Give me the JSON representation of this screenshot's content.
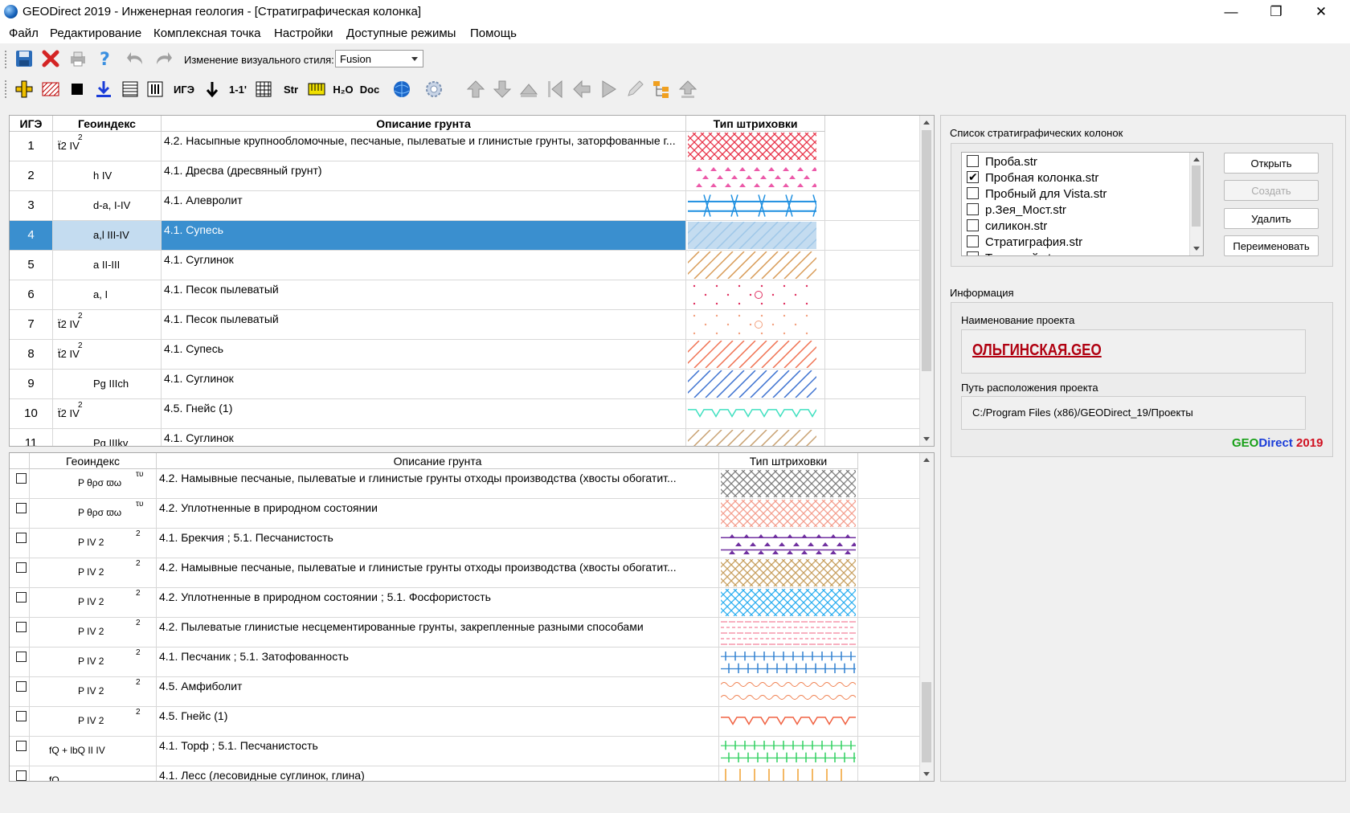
{
  "window": {
    "title": "GEODirect 2019 - Инженерная геология - [Стратиграфическая колонка]"
  },
  "menu": [
    "Файл",
    "Редактирование",
    "Комплексная точка",
    "Настройки",
    "Доступные режимы",
    "Помощь"
  ],
  "toolbar1": {
    "icons": [
      "save-icon",
      "delete-icon",
      "print-icon",
      "help-icon",
      "undo-icon",
      "redo-icon"
    ],
    "style_label": "Изменение визуального стиля:",
    "style_value": "Fusion"
  },
  "toolbar2": {
    "text_buttons": {
      "ige": "ИГЭ",
      "section": "1-1'",
      "str": "Str",
      "h2o": "H₂O",
      "doc": "Doc"
    }
  },
  "top_table": {
    "headers": [
      "ИГЭ",
      "Геоиндекс",
      "Описание грунта",
      "Тип штриховки"
    ],
    "rows": [
      {
        "n": "1",
        "geo": "ẗ2 IV",
        "sup": "2",
        "desc": "4.2. Насыпные крупнообломочные, песчаные, пылеватые и глинистые грунты, заторфованные г...",
        "hatch": "crosshatch-red",
        "color": "#e8344a"
      },
      {
        "n": "2",
        "geo": "h    IV",
        "sup": "",
        "desc": "4.1. Дресва (дресвяный грунт)",
        "hatch": "triangles-pink",
        "color": "#ec5aa9"
      },
      {
        "n": "3",
        "geo": "d-a,  I-IV",
        "sup": "",
        "desc": "4.1. Алевролит",
        "hatch": "lines-blue",
        "color": "#1e8fe0"
      },
      {
        "n": "4",
        "geo": "a,l   III-IV",
        "sup": "",
        "desc": "4.1. Супесь",
        "hatch": "diag-lightblue",
        "color": "#9fc7e8"
      },
      {
        "n": "5",
        "geo": "a    II-III",
        "sup": "",
        "desc": "4.1. Суглинок",
        "hatch": "diag-brown",
        "color": "#d89a55"
      },
      {
        "n": "6",
        "geo": "a,    I",
        "sup": "",
        "desc": "4.1. Песок пылеватый",
        "hatch": "dots-pink",
        "color": "#e03060"
      },
      {
        "n": "7",
        "geo": "ẗ2 IV",
        "sup": "2",
        "desc": "4.1. Песок пылеватый",
        "hatch": "dots-peach",
        "color": "#f3a07e"
      },
      {
        "n": "8",
        "geo": "ẗ2 IV",
        "sup": "2",
        "desc": "4.1. Супесь",
        "hatch": "diag-orange",
        "color": "#f07050"
      },
      {
        "n": "9",
        "geo": "Pg   IIIch",
        "sup": "",
        "desc": "4.1. Суглинок",
        "hatch": "diag-blue",
        "color": "#3a70d0"
      },
      {
        "n": "10",
        "geo": "ẗ2 IV",
        "sup": "2",
        "desc": "4.5. Гнейс (1)",
        "hatch": "zigzag-cyan",
        "color": "#40e0c0"
      },
      {
        "n": "11",
        "geo": "Pg   IIIkv",
        "sup": "",
        "desc": "4.1. Суглинок",
        "hatch": "diag-brown",
        "color": "#c8a070"
      }
    ]
  },
  "bottom_table": {
    "headers": [
      "Геоиндекс",
      "Описание грунта",
      "Тип штриховки"
    ],
    "rows": [
      {
        "geo": "P   θρσ ϖω",
        "sup": "τυ",
        "desc": "4.2. Намывные песчаные, пылеватые и глинистые грунты отходы производства (хвосты обогатит...",
        "hatch": "cross-gray",
        "color": "#808080"
      },
      {
        "geo": "P   θρσ ϖω",
        "sup": "τυ",
        "desc": "4.2. Уплотненные в природном состоянии",
        "hatch": "cross-salmon",
        "color": "#f4a090"
      },
      {
        "geo": "P   IV 2",
        "sup": "2",
        "desc": "4.1. Брекчия ; 5.1. Песчанистость",
        "hatch": "tri-purple",
        "color": "#7030a0"
      },
      {
        "geo": "P   IV 2",
        "sup": "2",
        "desc": "4.2. Намывные песчаные, пылеватые и глинистые грунты отходы производства (хвосты обогатит...",
        "hatch": "cross-tan",
        "color": "#c8a060"
      },
      {
        "geo": "P   IV 2",
        "sup": "2",
        "desc": "4.2. Уплотненные в природном состоянии ; 5.1. Фосфористость",
        "hatch": "cross-cyan",
        "color": "#30b0f0"
      },
      {
        "geo": "P   IV 2",
        "sup": "2",
        "desc": "4.2. Пылеватые глинистые несцементированные грунты, закрепленные разными способами",
        "hatch": "dash-pink",
        "color": "#f06080"
      },
      {
        "geo": "P   IV 2",
        "sup": "2",
        "desc": "4.1. Песчаник ; 5.1. Затофованность",
        "hatch": "bars-blue",
        "color": "#3080d0"
      },
      {
        "geo": "P   IV 2",
        "sup": "2",
        "desc": "4.5. Амфиболит",
        "hatch": "wave-orange",
        "color": "#f08050"
      },
      {
        "geo": "P   IV 2",
        "sup": "2",
        "desc": "4.5. Гнейс (1)",
        "hatch": "zigzag-orange",
        "color": "#f06040"
      },
      {
        "geo": "fQ   +   lbQ  II   IV",
        "sup": "",
        "desc": "4.1. Торф ; 5.1. Песчанистость",
        "hatch": "bars-green",
        "color": "#30d060"
      },
      {
        "geo": "fQ",
        "sup": "",
        "desc": "4.1. Лесс (лесовидные суглинок, глина)",
        "hatch": "ticks-orange",
        "color": "#f0a030"
      }
    ]
  },
  "right": {
    "list_title": "Список стратиграфических колонок",
    "files": [
      {
        "name": "Проба.str",
        "checked": false
      },
      {
        "name": "Пробная колонка.str",
        "checked": true
      },
      {
        "name": "Пробный для Vista.str",
        "checked": false
      },
      {
        "name": "р.Зея_Мост.str",
        "checked": false
      },
      {
        "name": "силикон.str",
        "checked": false
      },
      {
        "name": "Стратиграфия.str",
        "checked": false
      },
      {
        "name": "Тестовый.str",
        "checked": false
      }
    ],
    "buttons": {
      "open": "Открыть",
      "create": "Создать",
      "delete": "Удалить",
      "rename": "Переименовать"
    },
    "info_title": "Информация",
    "project_name_label": "Наименование проекта",
    "project_name": "ОЛЬГИНСКАЯ.GEO",
    "project_path_label": "Путь расположения проекта",
    "project_path": "C:/Program Files (x86)/GEODirect_19/Проекты",
    "logo": {
      "geo": "GEO",
      "direct": "Direct",
      "year": "2019"
    }
  }
}
